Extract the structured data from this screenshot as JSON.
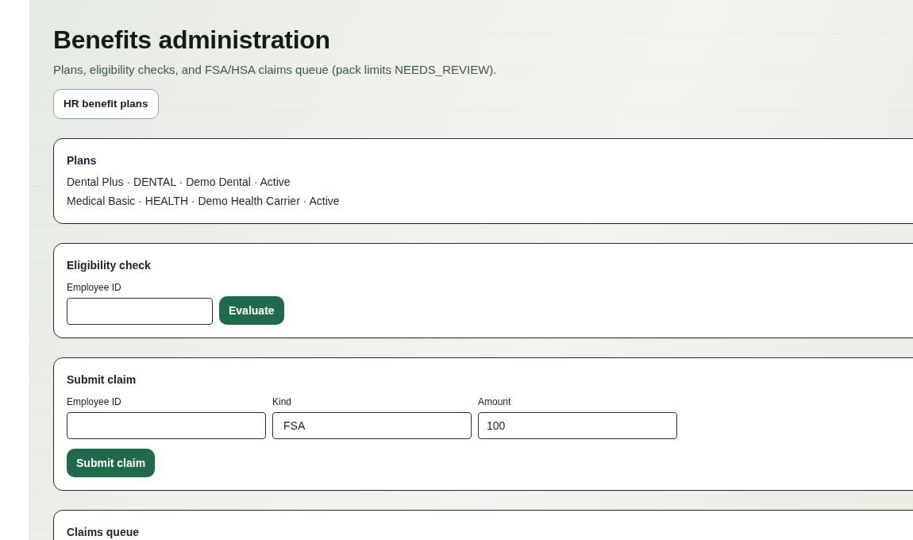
{
  "page": {
    "title": "Benefits administration",
    "subtitle": "Plans, eligibility checks, and FSA/HSA claims queue (pack limits NEEDS_REVIEW).",
    "buttons": [
      "HR benefit plans"
    ]
  },
  "plans": {
    "title": "Plans",
    "items": [
      "Dental Plus · DENTAL · Demo Dental · Active",
      "Medical Basic · HEALTH · Demo Health Carrier · Active"
    ]
  },
  "eligibility_check": {
    "title": "Eligibility check",
    "fields": [
      {
        "label": "Employee ID",
        "kind": "text"
      }
    ],
    "button": "Evaluate"
  },
  "submit_claim": {
    "title": "Submit claim",
    "fields": [
      {
        "label": "Employee ID",
        "kind": "text"
      },
      {
        "label": "Kind",
        "kind": "select",
        "value": "FSA"
      },
      {
        "label": "Amount",
        "kind": "text",
        "value": "100"
      }
    ],
    "button": "Submit claim"
  },
  "claims_queue": {
    "title": "Claims queue"
  }
}
